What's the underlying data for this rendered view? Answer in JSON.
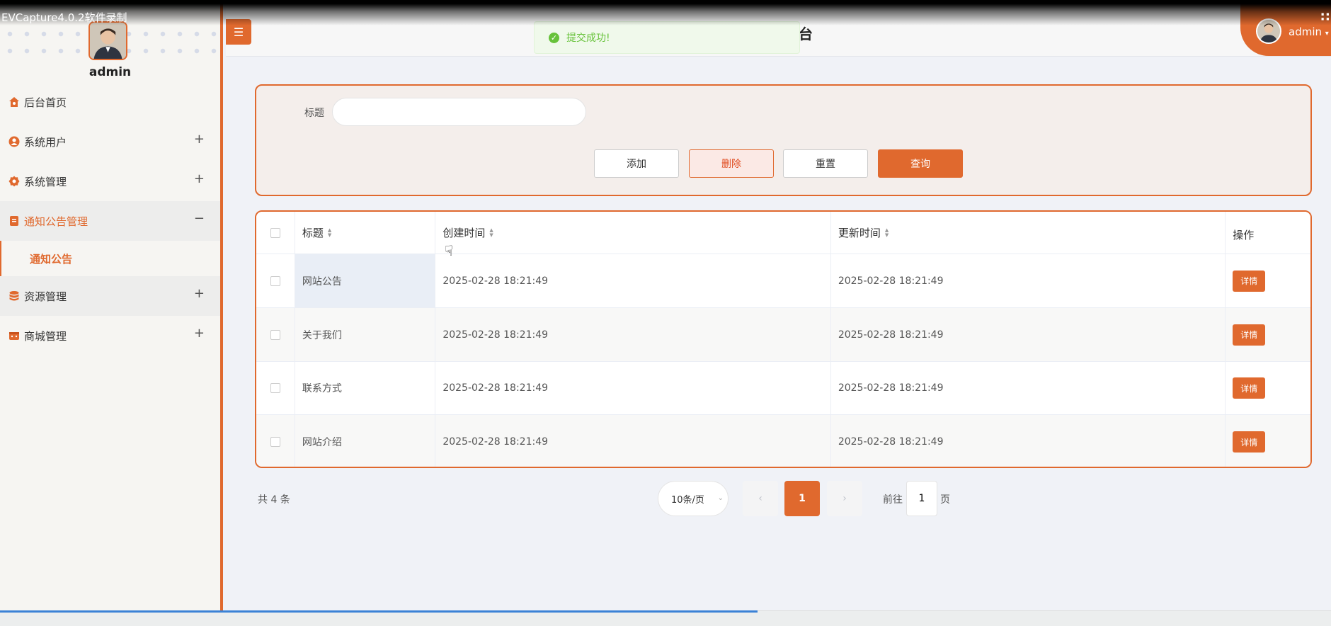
{
  "recorder": {
    "title": "EVCapture4.0.2软件录制"
  },
  "sidebar": {
    "username": "admin",
    "items": [
      {
        "label": "后台首页",
        "icon": "home-icon",
        "expand": ""
      },
      {
        "label": "系统用户",
        "icon": "user-icon",
        "expand": "+"
      },
      {
        "label": "系统管理",
        "icon": "gear-icon",
        "expand": "+"
      },
      {
        "label": "通知公告管理",
        "icon": "document-icon",
        "expand": "−"
      },
      {
        "label": "资源管理",
        "icon": "database-icon",
        "expand": "+"
      },
      {
        "label": "商城管理",
        "icon": "shop-icon",
        "expand": "+"
      }
    ],
    "subitem": {
      "label": "通知公告"
    }
  },
  "header": {
    "title": "台",
    "toast": "提交成功!",
    "user": "admin"
  },
  "search": {
    "label": "标题",
    "value": "",
    "add": "添加",
    "delete": "删除",
    "reset": "重置",
    "query": "查询"
  },
  "table": {
    "columns": [
      "标题",
      "创建时间",
      "更新时间",
      "操作"
    ],
    "rows": [
      {
        "title": "网站公告",
        "created": "2025-02-28 18:21:49",
        "updated": "2025-02-28 18:21:49",
        "action": "详情"
      },
      {
        "title": "关于我们",
        "created": "2025-02-28 18:21:49",
        "updated": "2025-02-28 18:21:49",
        "action": "详情"
      },
      {
        "title": "联系方式",
        "created": "2025-02-28 18:21:49",
        "updated": "2025-02-28 18:21:49",
        "action": "详情"
      },
      {
        "title": "网站介绍",
        "created": "2025-02-28 18:21:49",
        "updated": "2025-02-28 18:21:49",
        "action": "详情"
      }
    ]
  },
  "pagination": {
    "total": "共 4 条",
    "page_size": "10条/页",
    "current_page": "1",
    "goto_label": "前往",
    "goto_value": "1",
    "goto_suffix": "页"
  },
  "colors": {
    "accent": "#e0692e",
    "success": "#67c23a"
  }
}
